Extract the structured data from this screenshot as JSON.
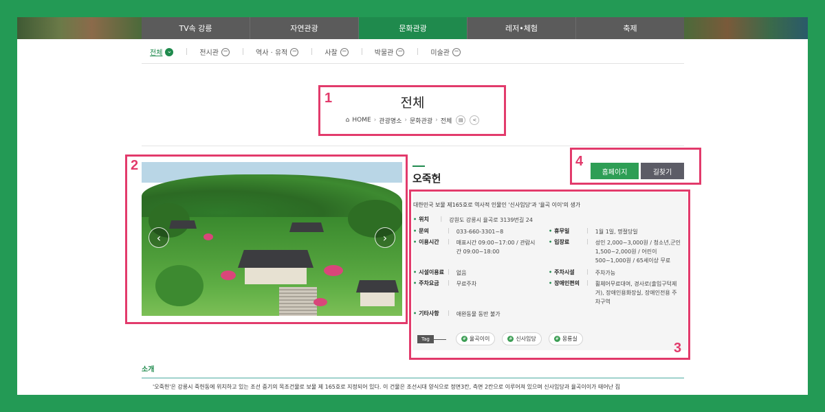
{
  "topnav": {
    "items": [
      {
        "label": "TV속 강릉",
        "active": false
      },
      {
        "label": "자연관광",
        "active": false
      },
      {
        "label": "문화관광",
        "active": true
      },
      {
        "label": "레저•체험",
        "active": false
      },
      {
        "label": "축제",
        "active": false
      }
    ]
  },
  "subnav": {
    "items": [
      {
        "label": "전체",
        "active": true
      },
      {
        "label": "전시관",
        "active": false
      },
      {
        "label": "역사 · 유적",
        "active": false
      },
      {
        "label": "사찰",
        "active": false
      },
      {
        "label": "박물관",
        "active": false
      },
      {
        "label": "미술관",
        "active": false
      }
    ]
  },
  "page": {
    "title": "전체",
    "breadcrumb": [
      "HOME",
      "관광명소",
      "문화관광",
      "전체"
    ]
  },
  "annotations": [
    "1",
    "2",
    "3",
    "4"
  ],
  "place": {
    "name": "오죽헌",
    "description": "대한민국 보물 제165호로 역사적 인물인 '신사임당'과 '율곡 이이'의 생가",
    "homepage_label": "홈페이지",
    "directions_label": "길찾기",
    "fields": {
      "location": {
        "key": "위치",
        "value": "강원도 강릉시 율곡로 3139번길 24"
      },
      "contact": {
        "key": "문의",
        "value": "033-660-3301~8"
      },
      "closed": {
        "key": "휴무일",
        "value": "1월 1일, 명절당일"
      },
      "hours": {
        "key": "이용시간",
        "value": "매표시간 09:00~17:00 / 관람시간 09:00~18:00"
      },
      "fee": {
        "key": "입장료",
        "value": "성인 2,000~3,000원 / 청소년,군인 1,500~2,000원 / 어린이 500~1,000원 / 65세이상 무료"
      },
      "facility_fee": {
        "key": "시설이용료",
        "value": "없음"
      },
      "parking": {
        "key": "주차시설",
        "value": "주차가능"
      },
      "parking_fee": {
        "key": "주차요금",
        "value": "무료주차"
      },
      "accessibility": {
        "key": "장애인편의",
        "value": "휠체어무료대여, 경사로(출입구턱제거), 장애인용화장실, 장애인전용 주차구역"
      },
      "etc": {
        "key": "기타사항",
        "value": "애완동물 동반 불가"
      }
    },
    "tag_label": "Tag",
    "tags": [
      "율곡이이",
      "신사임당",
      "몽룡실"
    ]
  },
  "intro": {
    "title": "소개",
    "text": "'오죽헌'은 강릉시 죽헌동에 위치하고 있는 조선 중기의 목조건물로 보물 제 165호로 지정되어 있다. 이 건물은 조선시대 양식으로 정면3칸, 측면 2칸으로 이루어져 있으며 신사임당과 율곡이이가 태어난 집"
  },
  "colors": {
    "accent": "#1f8a4d",
    "annotation": "#e23a6b",
    "frame": "#239a55"
  }
}
